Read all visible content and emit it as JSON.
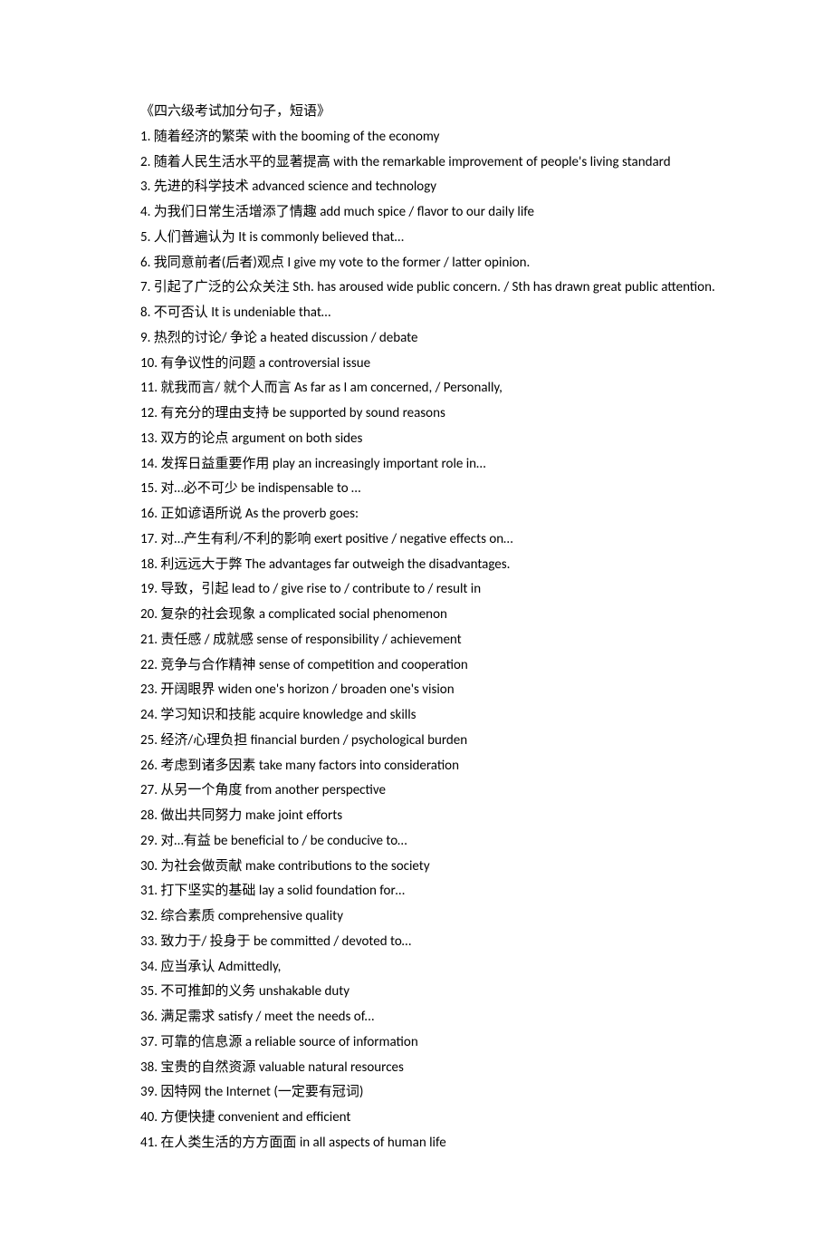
{
  "title": "《四六级考试加分句子，短语》",
  "items": [
    {
      "num": "1.",
      "zh": "随着经济的繁荣",
      "en": "with the booming of the economy"
    },
    {
      "num": "2.",
      "zh": "随着人民生活水平的显著提高",
      "en": "with the remarkable improvement of people's living standard",
      "wrap": true
    },
    {
      "num": "3.",
      "zh": "先进的科学技术",
      "en": "advanced science and technology"
    },
    {
      "num": "4.",
      "zh": "为我们日常生活增添了情趣",
      "en": "add much spice / flavor to our daily life"
    },
    {
      "num": "5.",
      "zh": "人们普遍认为",
      "en": "It is commonly believed that…"
    },
    {
      "num": "6.",
      "zh": "我同意前者(后者)观点",
      "en": "I give my vote to the former / latter opinion."
    },
    {
      "num": "7.",
      "zh": "引起了广泛的公众关注",
      "en": "Sth. has aroused wide public concern. / Sth has drawn great public attention.",
      "wrap": true
    },
    {
      "num": "8.",
      "zh": "不可否认",
      "en": "It is undeniable that…"
    },
    {
      "num": "9.",
      "zh": "热烈的讨论/ 争论",
      "en": "a heated discussion / debate"
    },
    {
      "num": "10.",
      "zh": "有争议性的问题",
      "en": "a controversial issue"
    },
    {
      "num": "11.",
      "zh": "就我而言/ 就个人而言",
      "en": "As far as I am concerned, / Personally,"
    },
    {
      "num": "12.",
      "zh": "有充分的理由支持",
      "en": "be supported by sound reasons"
    },
    {
      "num": "13.",
      "zh": "双方的论点",
      "en": "argument on both sides"
    },
    {
      "num": "14.",
      "zh": "发挥日益重要作用",
      "en": "play an increasingly important role in…"
    },
    {
      "num": "15.",
      "zh": "对…必不可少",
      "en": "be indispensable to …"
    },
    {
      "num": "16.",
      "zh": "正如谚语所说",
      "en": "As the proverb goes:"
    },
    {
      "num": "17.",
      "zh": "对…产生有利/不利的影响",
      "en": "exert positive / negative effects on…"
    },
    {
      "num": "18.",
      "zh": "利远远大于弊",
      "en": "The advantages far outweigh the disadvantages."
    },
    {
      "num": "19.",
      "zh": "导致，引起",
      "en": "lead to / give rise to / contribute to / result in"
    },
    {
      "num": "20.",
      "zh": "复杂的社会现象",
      "en": "a complicated social phenomenon"
    },
    {
      "num": "21.",
      "zh": "责任感 / 成就感",
      "en": "sense of responsibility / achievement"
    },
    {
      "num": "22.",
      "zh": "竞争与合作精神",
      "en": "sense of competition and cooperation"
    },
    {
      "num": "23.",
      "zh": "开阔眼界",
      "en": "widen one's horizon / broaden one's vision"
    },
    {
      "num": "24.",
      "zh": "学习知识和技能",
      "en": "acquire knowledge and skills"
    },
    {
      "num": "25.",
      "zh": "经济/心理负担",
      "en": "financial burden / psychological burden"
    },
    {
      "num": "26.",
      "zh": "考虑到诸多因素",
      "en": "take many factors into consideration"
    },
    {
      "num": "27.",
      "zh": "从另一个角度",
      "en": "from another perspective"
    },
    {
      "num": "28.",
      "zh": "做出共同努力",
      "en": "make joint efforts"
    },
    {
      "num": "29.",
      "zh": "对…有益",
      "en": "be beneficial to / be conducive to…"
    },
    {
      "num": "30.",
      "zh": "为社会做贡献",
      "en": "make contributions to the society"
    },
    {
      "num": "31.",
      "zh": "打下坚实的基础",
      "en": "lay a solid foundation for…"
    },
    {
      "num": "32.",
      "zh": "综合素质",
      "en": "comprehensive quality"
    },
    {
      "num": "33.",
      "zh": "致力于/ 投身于",
      "en": "be committed / devoted to…"
    },
    {
      "num": "34.",
      "zh": "应当承认",
      "en": "Admittedly,"
    },
    {
      "num": "35.",
      "zh": "不可推卸的义务",
      "en": "unshakable duty"
    },
    {
      "num": "36.",
      "zh": "满足需求",
      "en": "satisfy / meet the needs of..."
    },
    {
      "num": "37.",
      "zh": "可靠的信息源",
      "en": "a reliable source of information"
    },
    {
      "num": "38.",
      "zh": "宝贵的自然资源",
      "en": "valuable natural resources"
    },
    {
      "num": "39.",
      "zh": "因特网",
      "en": "the Internet (一定要有冠词)"
    },
    {
      "num": "40.",
      "zh": "方便快捷",
      "en": "convenient and efficient"
    },
    {
      "num": "41.",
      "zh": "在人类生活的方方面面",
      "en": "in all aspects of human life"
    }
  ]
}
